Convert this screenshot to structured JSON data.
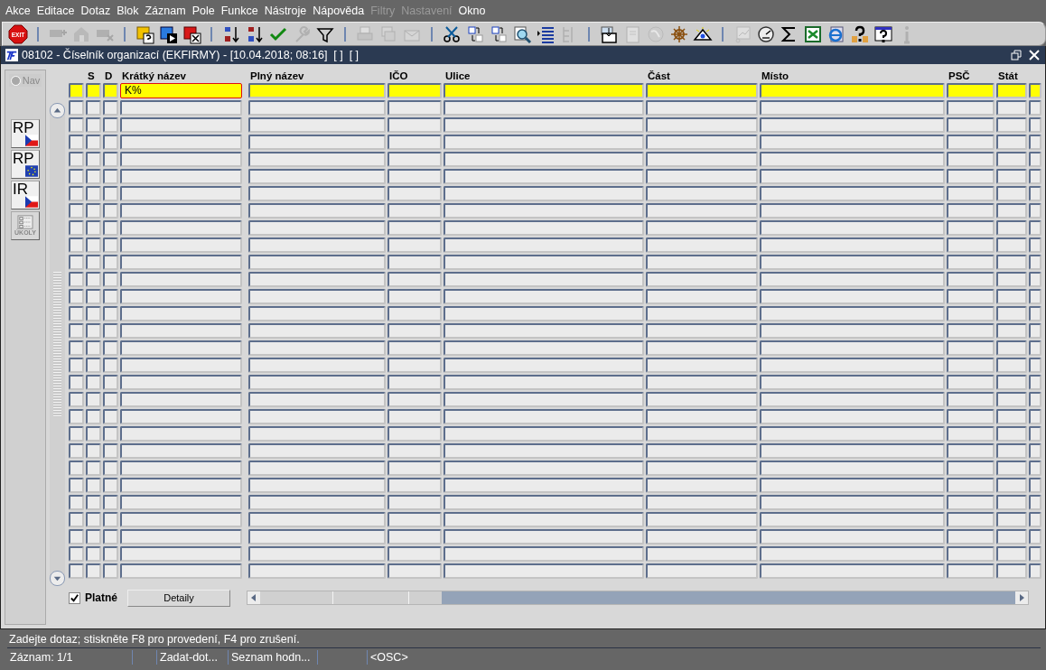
{
  "menu": [
    {
      "label": "Akce",
      "disabled": false
    },
    {
      "label": "Editace",
      "disabled": false
    },
    {
      "label": "Dotaz",
      "disabled": false
    },
    {
      "label": "Blok",
      "disabled": false
    },
    {
      "label": "Záznam",
      "disabled": false
    },
    {
      "label": "Pole",
      "disabled": false
    },
    {
      "label": "Funkce",
      "disabled": false
    },
    {
      "label": "Nástroje",
      "disabled": false
    },
    {
      "label": "Nápověda",
      "disabled": false
    },
    {
      "label": "Filtry",
      "disabled": true
    },
    {
      "label": "Nastavení",
      "disabled": true
    },
    {
      "label": "Okno",
      "disabled": false
    }
  ],
  "toolbar": [
    {
      "kind": "exit",
      "label": "EXIT",
      "disabled": false
    },
    {
      "kind": "sep"
    },
    {
      "kind": "add",
      "disabled": true
    },
    {
      "kind": "folder",
      "disabled": true
    },
    {
      "kind": "delete",
      "disabled": true
    },
    {
      "kind": "sep"
    },
    {
      "kind": "query-enter",
      "disabled": false
    },
    {
      "kind": "query-run",
      "disabled": false
    },
    {
      "kind": "query-cancel",
      "disabled": false
    },
    {
      "kind": "sep"
    },
    {
      "kind": "sort-down",
      "disabled": false
    },
    {
      "kind": "sort-up",
      "disabled": false
    },
    {
      "kind": "check",
      "disabled": false
    },
    {
      "kind": "wrench",
      "disabled": true
    },
    {
      "kind": "filter",
      "disabled": false
    },
    {
      "kind": "sep"
    },
    {
      "kind": "print",
      "disabled": true
    },
    {
      "kind": "copy",
      "disabled": true
    },
    {
      "kind": "mail",
      "disabled": true
    },
    {
      "kind": "sep"
    },
    {
      "kind": "cut",
      "disabled": false
    },
    {
      "kind": "swap",
      "disabled": false
    },
    {
      "kind": "swap",
      "disabled": false
    },
    {
      "kind": "zoom",
      "disabled": false
    },
    {
      "kind": "list",
      "disabled": false
    },
    {
      "kind": "tree",
      "disabled": true
    },
    {
      "kind": "sep"
    },
    {
      "kind": "import",
      "disabled": false
    },
    {
      "kind": "document",
      "disabled": true
    },
    {
      "kind": "globe",
      "disabled": true
    },
    {
      "kind": "wheel",
      "disabled": false
    },
    {
      "kind": "pyramid",
      "disabled": false
    },
    {
      "kind": "sep"
    },
    {
      "kind": "chart",
      "disabled": true
    },
    {
      "kind": "gauge",
      "disabled": false
    },
    {
      "kind": "sigma",
      "disabled": false
    },
    {
      "kind": "sheet",
      "disabled": false
    },
    {
      "kind": "browser",
      "disabled": false
    },
    {
      "kind": "help-people",
      "disabled": false
    },
    {
      "kind": "help",
      "disabled": false
    },
    {
      "kind": "info",
      "disabled": true
    }
  ],
  "window": {
    "title": "08102 - Číselník organizací (EKFIRMY) - [10.04.2018; 08:16]  [ ]  [ ]"
  },
  "nav": {
    "label": "Nav",
    "disabled": true
  },
  "side_buttons": [
    {
      "label": "RP",
      "kind": "cz",
      "disabled": false
    },
    {
      "label": "RP",
      "kind": "eu",
      "disabled": false
    },
    {
      "label": "IR",
      "kind": "cz",
      "disabled": false
    },
    {
      "label": "ÚKOLY",
      "kind": "tasks",
      "disabled": true
    }
  ],
  "table": {
    "columns": [
      "",
      "S",
      "D",
      "Krátký název",
      "Plný název",
      "IČO",
      "Ulice",
      "Část",
      "Místo",
      "PSČ",
      "Stát",
      ""
    ],
    "rows": [
      {
        "selected": true,
        "short_name": "K%",
        "focused": true
      },
      {
        "selected": false
      },
      {
        "selected": false
      },
      {
        "selected": false
      },
      {
        "selected": false
      },
      {
        "selected": false
      },
      {
        "selected": false
      },
      {
        "selected": false
      },
      {
        "selected": false
      },
      {
        "selected": false
      },
      {
        "selected": false
      },
      {
        "selected": false
      },
      {
        "selected": false
      },
      {
        "selected": false
      },
      {
        "selected": false
      },
      {
        "selected": false
      },
      {
        "selected": false
      },
      {
        "selected": false
      },
      {
        "selected": false
      },
      {
        "selected": false
      },
      {
        "selected": false
      },
      {
        "selected": false
      },
      {
        "selected": false
      },
      {
        "selected": false
      },
      {
        "selected": false
      },
      {
        "selected": false
      },
      {
        "selected": false
      },
      {
        "selected": false
      },
      {
        "selected": false
      }
    ]
  },
  "platne": {
    "label": "Platné",
    "checked": true
  },
  "details_button": "Detaily",
  "status_bar": {
    "message": "Zadejte dotaz; stiskněte F8 pro provedení, F4 pro zrušení.",
    "fields": [
      {
        "kind": "text",
        "text": "Záznam: 1/1"
      },
      {
        "kind": "blank"
      },
      {
        "kind": "text",
        "text": "Zadat-dot..."
      },
      {
        "kind": "text",
        "text": "Seznam hodn..."
      },
      {
        "kind": "blank"
      },
      {
        "kind": "text",
        "text": "<OSC>"
      }
    ]
  }
}
